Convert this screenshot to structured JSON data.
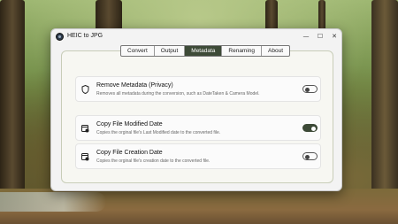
{
  "window": {
    "title": "HEIC to JPG",
    "controls": {
      "minimize": "—",
      "maximize": "☐",
      "close": "✕"
    }
  },
  "tabs": [
    {
      "label": "Convert",
      "active": false
    },
    {
      "label": "Output",
      "active": false
    },
    {
      "label": "Metadata",
      "active": true
    },
    {
      "label": "Renaming",
      "active": false
    },
    {
      "label": "About",
      "active": false
    }
  ],
  "settings": [
    {
      "icon": "shield-icon",
      "title": "Remove Metadata (Privacy)",
      "description": "Removes all metadata during the conversion, such as DateTaken & Camera Model.",
      "enabled": false
    },
    {
      "icon": "calendar-edit-icon",
      "title": "Copy File Modified Date",
      "description": "Copies the orginal file's Last Modified date to the converted file.",
      "enabled": true
    },
    {
      "icon": "calendar-add-icon",
      "title": "Copy File Creation Date",
      "description": "Copies the orginal file's creation date to the converted file.",
      "enabled": false
    }
  ],
  "colors": {
    "accent": "#3d4a37"
  }
}
